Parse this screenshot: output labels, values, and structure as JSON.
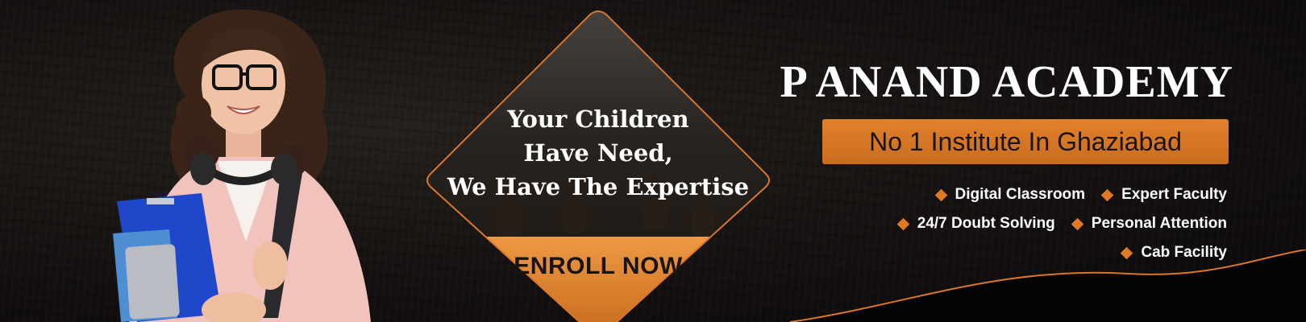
{
  "brand": {
    "name": "P ANAND ACADEMY"
  },
  "subtitle": "No 1 Institute In Ghaziabad",
  "tagline": [
    "Your Children",
    "Have Need,",
    "We Have The Expertise"
  ],
  "cta": {
    "label": "ENROLL NOW"
  },
  "features": [
    [
      "Digital Classroom",
      "Expert Faculty"
    ],
    [
      "24/7 Doubt Solving",
      "Personal Attention"
    ],
    [
      "Cab Facility"
    ]
  ],
  "colors": {
    "accent": "#e07a22",
    "background": "#141110",
    "text": "#ffffff"
  },
  "icons": {
    "bullet": "diamond-bullet-icon"
  }
}
